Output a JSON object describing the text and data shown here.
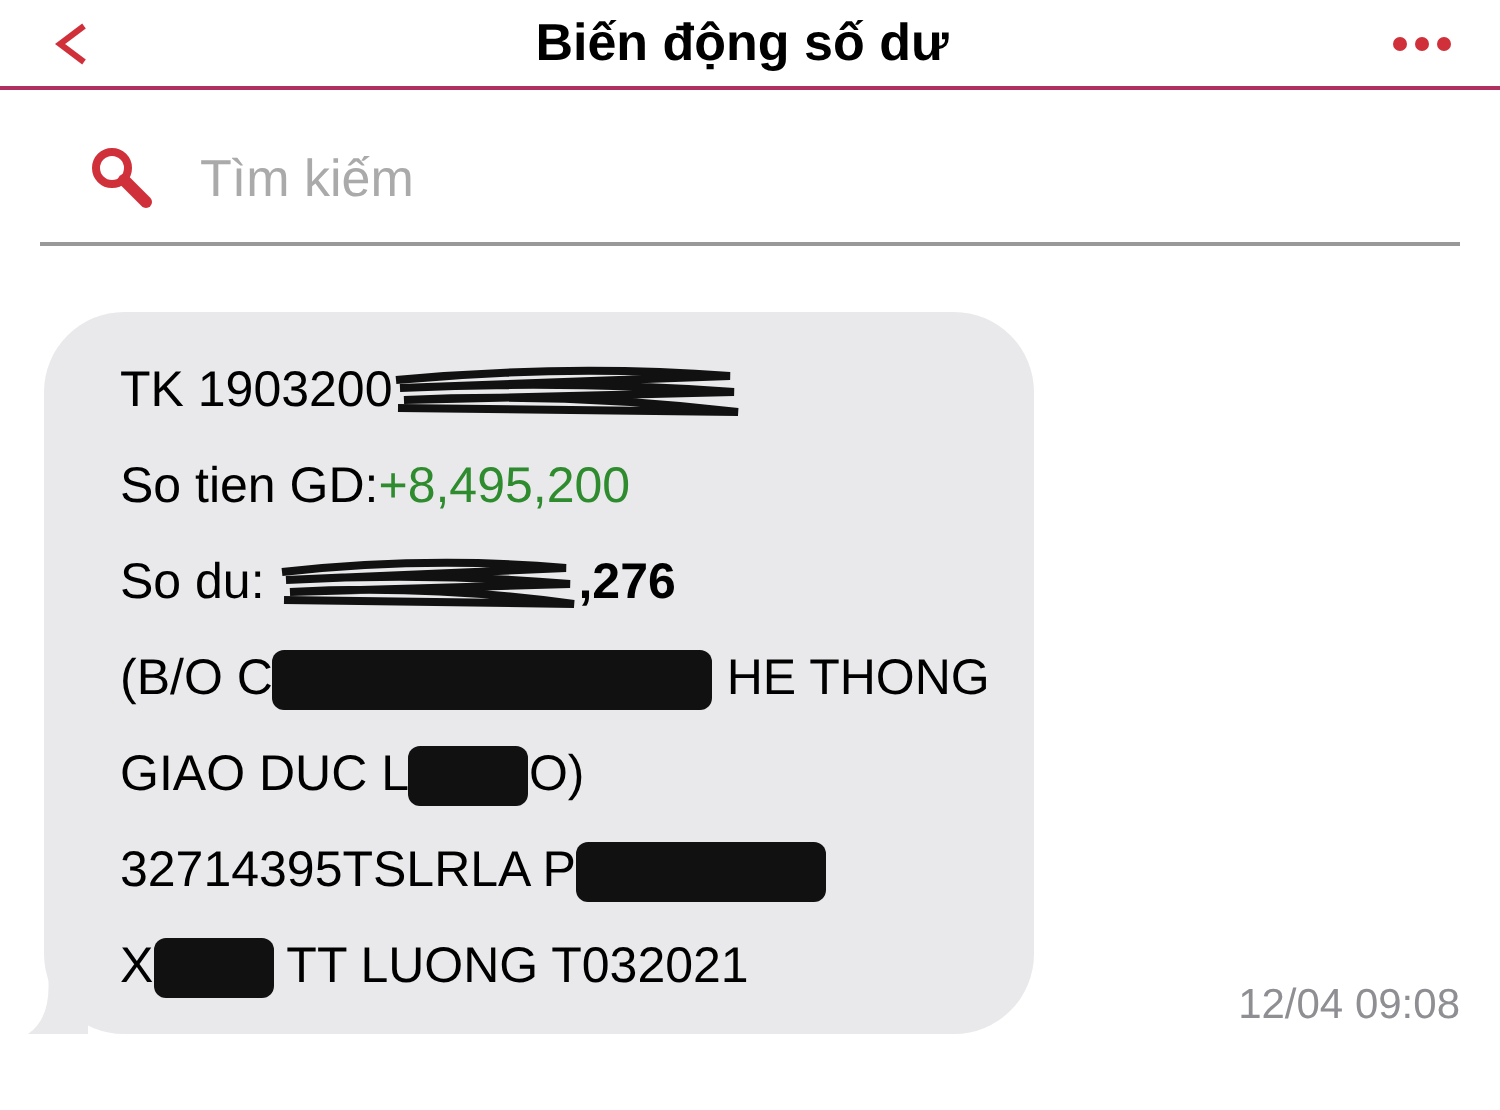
{
  "header": {
    "title": "Biến động số dư"
  },
  "search": {
    "placeholder": "Tìm kiếm"
  },
  "message": {
    "lines": [
      {
        "segments": [
          {
            "kind": "text",
            "text": "TK 1903200"
          },
          {
            "kind": "scribble"
          }
        ]
      },
      {
        "segments": [
          {
            "kind": "text",
            "text": "So tien GD:"
          },
          {
            "kind": "amount",
            "text": "+8,495,200",
            "color": "#2e8b2e"
          }
        ]
      },
      {
        "segments": [
          {
            "kind": "text",
            "text": "So du: "
          },
          {
            "kind": "scribble"
          },
          {
            "kind": "bold",
            "text": ",276"
          }
        ]
      },
      {
        "segments": [
          {
            "kind": "text",
            "text": "(B/O C"
          },
          {
            "kind": "blackout"
          },
          {
            "kind": "text",
            "text": " HE THONG"
          }
        ]
      },
      {
        "segments": [
          {
            "kind": "text",
            "text": "GIAO DUC L"
          },
          {
            "kind": "blackout"
          },
          {
            "kind": "text",
            "text": "O)"
          }
        ]
      },
      {
        "segments": [
          {
            "kind": "text",
            "text": "32714395TSLRLA P"
          },
          {
            "kind": "blackout"
          }
        ]
      },
      {
        "segments": [
          {
            "kind": "text",
            "text": "X"
          },
          {
            "kind": "blackout"
          },
          {
            "kind": "text",
            "text": " TT LUONG T032021"
          }
        ]
      }
    ],
    "time": "12/04 09:08"
  }
}
